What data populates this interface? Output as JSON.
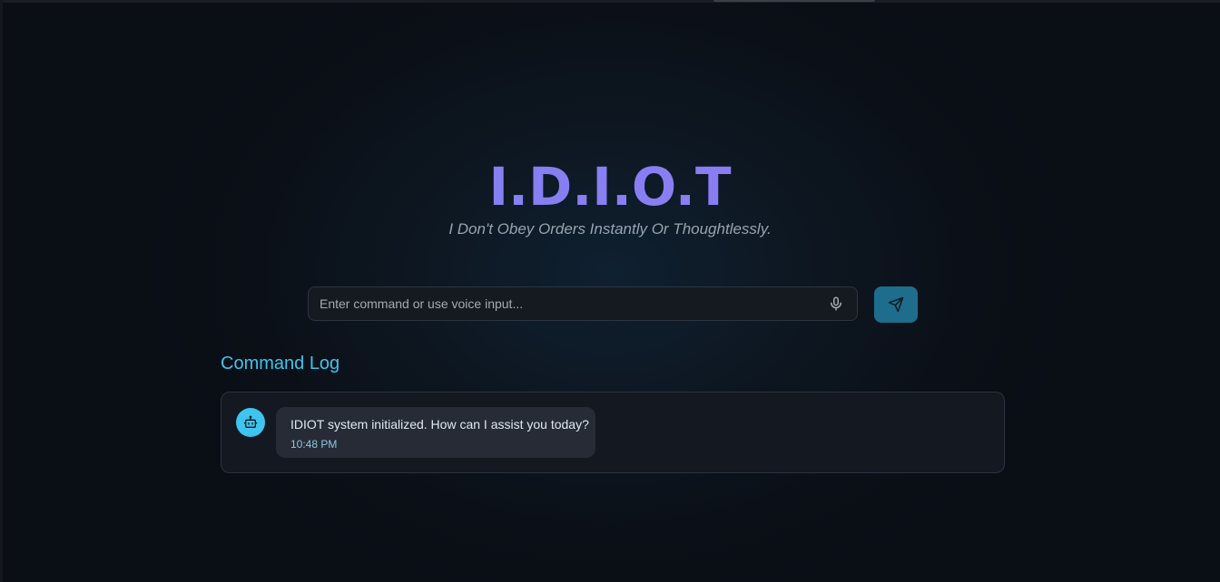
{
  "app": {
    "title": "I.D.I.O.T",
    "subtitle": "I Don't Obey Orders Instantly Or Thoughtlessly."
  },
  "command": {
    "input_value": "",
    "placeholder": "Enter command or use voice input...",
    "mic_icon": "microphone-icon",
    "send_icon": "send-icon"
  },
  "log": {
    "title": "Command Log",
    "messages": [
      {
        "avatar_icon": "bot-icon",
        "text": "IDIOT system initialized. How can I assist you today?",
        "time": "10:48 PM"
      }
    ]
  },
  "colors": {
    "accent": "#3fc4ec",
    "title_gradient_start": "#7b86f4",
    "title_gradient_end": "#9a78f0",
    "send_button": "#1e6d8c",
    "background": "#0b1018"
  }
}
